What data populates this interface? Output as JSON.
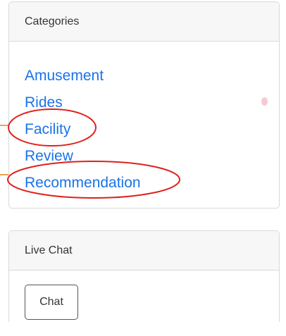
{
  "categories": {
    "title": "Categories",
    "items": [
      {
        "label": "Amusement"
      },
      {
        "label": "Rides"
      },
      {
        "label": "Facility"
      },
      {
        "label": "Review"
      },
      {
        "label": "Recommendation"
      }
    ]
  },
  "live_chat": {
    "title": "Live Chat",
    "button_label": "Chat"
  },
  "colors": {
    "link": "#1a73e8",
    "annotation_circle": "#e0201c",
    "annotation_line": "#e8821c"
  }
}
